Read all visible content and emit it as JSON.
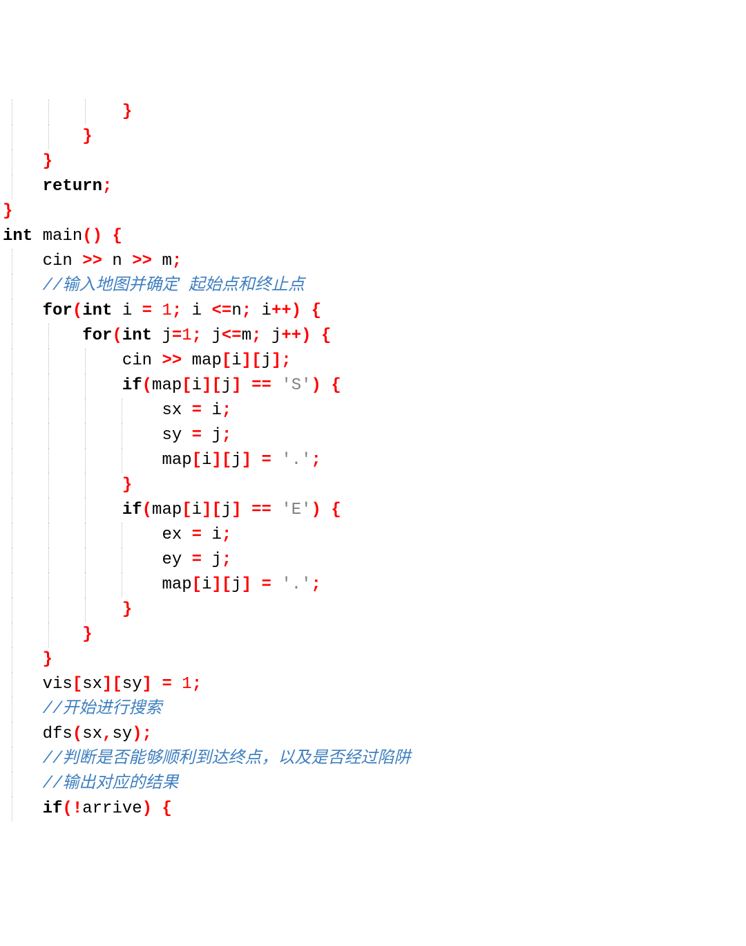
{
  "lines": [
    {
      "indent": "            ",
      "tokens": [
        {
          "t": "}",
          "c": "br"
        }
      ]
    },
    {
      "indent": "        ",
      "tokens": [
        {
          "t": "}",
          "c": "br"
        }
      ]
    },
    {
      "indent": "    ",
      "tokens": [
        {
          "t": "}",
          "c": "br"
        }
      ]
    },
    {
      "indent": "    ",
      "tokens": [
        {
          "t": "return",
          "c": "kw"
        },
        {
          "t": ";",
          "c": "op"
        }
      ]
    },
    {
      "indent": "",
      "tokens": [
        {
          "t": "}",
          "c": "br"
        }
      ]
    },
    {
      "indent": "",
      "tokens": [
        {
          "t": "int ",
          "c": "kw"
        },
        {
          "t": "main",
          "c": "id"
        },
        {
          "t": "()",
          "c": "br"
        },
        {
          "t": " ",
          "c": "id"
        },
        {
          "t": "{",
          "c": "br"
        }
      ]
    },
    {
      "indent": "    ",
      "tokens": [
        {
          "t": "cin ",
          "c": "id"
        },
        {
          "t": ">>",
          "c": "op"
        },
        {
          "t": " n ",
          "c": "id"
        },
        {
          "t": ">>",
          "c": "op"
        },
        {
          "t": " m",
          "c": "id"
        },
        {
          "t": ";",
          "c": "op"
        }
      ]
    },
    {
      "indent": "    ",
      "tokens": [
        {
          "t": "//输入地图并确定 起始点和终止点",
          "c": "cm"
        }
      ]
    },
    {
      "indent": "    ",
      "tokens": [
        {
          "t": "for",
          "c": "kw"
        },
        {
          "t": "(",
          "c": "br"
        },
        {
          "t": "int ",
          "c": "kw"
        },
        {
          "t": "i ",
          "c": "id"
        },
        {
          "t": "= ",
          "c": "op"
        },
        {
          "t": "1",
          "c": "num"
        },
        {
          "t": ";",
          "c": "op"
        },
        {
          "t": " i ",
          "c": "id"
        },
        {
          "t": "<=",
          "c": "op"
        },
        {
          "t": "n",
          "c": "id"
        },
        {
          "t": ";",
          "c": "op"
        },
        {
          "t": " i",
          "c": "id"
        },
        {
          "t": "++",
          "c": "op"
        },
        {
          "t": ")",
          "c": "br"
        },
        {
          "t": " ",
          "c": "id"
        },
        {
          "t": "{",
          "c": "br"
        }
      ]
    },
    {
      "indent": "        ",
      "tokens": [
        {
          "t": "for",
          "c": "kw"
        },
        {
          "t": "(",
          "c": "br"
        },
        {
          "t": "int ",
          "c": "kw"
        },
        {
          "t": "j",
          "c": "id"
        },
        {
          "t": "=",
          "c": "op"
        },
        {
          "t": "1",
          "c": "num"
        },
        {
          "t": ";",
          "c": "op"
        },
        {
          "t": " j",
          "c": "id"
        },
        {
          "t": "<=",
          "c": "op"
        },
        {
          "t": "m",
          "c": "id"
        },
        {
          "t": ";",
          "c": "op"
        },
        {
          "t": " j",
          "c": "id"
        },
        {
          "t": "++",
          "c": "op"
        },
        {
          "t": ")",
          "c": "br"
        },
        {
          "t": " ",
          "c": "id"
        },
        {
          "t": "{",
          "c": "br"
        }
      ]
    },
    {
      "indent": "            ",
      "tokens": [
        {
          "t": "cin ",
          "c": "id"
        },
        {
          "t": ">>",
          "c": "op"
        },
        {
          "t": " map",
          "c": "id"
        },
        {
          "t": "[",
          "c": "br"
        },
        {
          "t": "i",
          "c": "id"
        },
        {
          "t": "][",
          "c": "br"
        },
        {
          "t": "j",
          "c": "id"
        },
        {
          "t": "]",
          "c": "br"
        },
        {
          "t": ";",
          "c": "op"
        }
      ]
    },
    {
      "indent": "            ",
      "tokens": [
        {
          "t": "if",
          "c": "kw"
        },
        {
          "t": "(",
          "c": "br"
        },
        {
          "t": "map",
          "c": "id"
        },
        {
          "t": "[",
          "c": "br"
        },
        {
          "t": "i",
          "c": "id"
        },
        {
          "t": "][",
          "c": "br"
        },
        {
          "t": "j",
          "c": "id"
        },
        {
          "t": "]",
          "c": "br"
        },
        {
          "t": " ",
          "c": "id"
        },
        {
          "t": "==",
          "c": "op"
        },
        {
          "t": " ",
          "c": "id"
        },
        {
          "t": "'S'",
          "c": "str"
        },
        {
          "t": ")",
          "c": "br"
        },
        {
          "t": " ",
          "c": "id"
        },
        {
          "t": "{",
          "c": "br"
        }
      ]
    },
    {
      "indent": "                ",
      "tokens": [
        {
          "t": "sx ",
          "c": "id"
        },
        {
          "t": "=",
          "c": "op"
        },
        {
          "t": " i",
          "c": "id"
        },
        {
          "t": ";",
          "c": "op"
        }
      ]
    },
    {
      "indent": "                ",
      "tokens": [
        {
          "t": "sy ",
          "c": "id"
        },
        {
          "t": "=",
          "c": "op"
        },
        {
          "t": " j",
          "c": "id"
        },
        {
          "t": ";",
          "c": "op"
        }
      ]
    },
    {
      "indent": "                ",
      "tokens": [
        {
          "t": "map",
          "c": "id"
        },
        {
          "t": "[",
          "c": "br"
        },
        {
          "t": "i",
          "c": "id"
        },
        {
          "t": "][",
          "c": "br"
        },
        {
          "t": "j",
          "c": "id"
        },
        {
          "t": "]",
          "c": "br"
        },
        {
          "t": " ",
          "c": "id"
        },
        {
          "t": "=",
          "c": "op"
        },
        {
          "t": " ",
          "c": "id"
        },
        {
          "t": "'.'",
          "c": "str"
        },
        {
          "t": ";",
          "c": "op"
        }
      ]
    },
    {
      "indent": "            ",
      "tokens": [
        {
          "t": "}",
          "c": "br"
        }
      ]
    },
    {
      "indent": "            ",
      "tokens": [
        {
          "t": "if",
          "c": "kw"
        },
        {
          "t": "(",
          "c": "br"
        },
        {
          "t": "map",
          "c": "id"
        },
        {
          "t": "[",
          "c": "br"
        },
        {
          "t": "i",
          "c": "id"
        },
        {
          "t": "][",
          "c": "br"
        },
        {
          "t": "j",
          "c": "id"
        },
        {
          "t": "]",
          "c": "br"
        },
        {
          "t": " ",
          "c": "id"
        },
        {
          "t": "==",
          "c": "op"
        },
        {
          "t": " ",
          "c": "id"
        },
        {
          "t": "'E'",
          "c": "str"
        },
        {
          "t": ")",
          "c": "br"
        },
        {
          "t": " ",
          "c": "id"
        },
        {
          "t": "{",
          "c": "br"
        }
      ]
    },
    {
      "indent": "                ",
      "tokens": [
        {
          "t": "ex ",
          "c": "id"
        },
        {
          "t": "=",
          "c": "op"
        },
        {
          "t": " i",
          "c": "id"
        },
        {
          "t": ";",
          "c": "op"
        }
      ]
    },
    {
      "indent": "                ",
      "tokens": [
        {
          "t": "ey ",
          "c": "id"
        },
        {
          "t": "=",
          "c": "op"
        },
        {
          "t": " j",
          "c": "id"
        },
        {
          "t": ";",
          "c": "op"
        }
      ]
    },
    {
      "indent": "                ",
      "tokens": [
        {
          "t": "map",
          "c": "id"
        },
        {
          "t": "[",
          "c": "br"
        },
        {
          "t": "i",
          "c": "id"
        },
        {
          "t": "][",
          "c": "br"
        },
        {
          "t": "j",
          "c": "id"
        },
        {
          "t": "]",
          "c": "br"
        },
        {
          "t": " ",
          "c": "id"
        },
        {
          "t": "=",
          "c": "op"
        },
        {
          "t": " ",
          "c": "id"
        },
        {
          "t": "'.'",
          "c": "str"
        },
        {
          "t": ";",
          "c": "op"
        }
      ]
    },
    {
      "indent": "            ",
      "tokens": [
        {
          "t": "}",
          "c": "br"
        }
      ]
    },
    {
      "indent": "        ",
      "tokens": [
        {
          "t": "}",
          "c": "br"
        }
      ]
    },
    {
      "indent": "    ",
      "tokens": [
        {
          "t": "}",
          "c": "br"
        }
      ]
    },
    {
      "indent": "    ",
      "tokens": [
        {
          "t": "vis",
          "c": "id"
        },
        {
          "t": "[",
          "c": "br"
        },
        {
          "t": "sx",
          "c": "id"
        },
        {
          "t": "][",
          "c": "br"
        },
        {
          "t": "sy",
          "c": "id"
        },
        {
          "t": "]",
          "c": "br"
        },
        {
          "t": " ",
          "c": "id"
        },
        {
          "t": "=",
          "c": "op"
        },
        {
          "t": " ",
          "c": "id"
        },
        {
          "t": "1",
          "c": "num"
        },
        {
          "t": ";",
          "c": "op"
        }
      ]
    },
    {
      "indent": "    ",
      "tokens": [
        {
          "t": "//开始进行搜索",
          "c": "cm"
        }
      ]
    },
    {
      "indent": "    ",
      "tokens": [
        {
          "t": "dfs",
          "c": "id"
        },
        {
          "t": "(",
          "c": "br"
        },
        {
          "t": "sx",
          "c": "id"
        },
        {
          "t": ",",
          "c": "op"
        },
        {
          "t": "sy",
          "c": "id"
        },
        {
          "t": ")",
          "c": "br"
        },
        {
          "t": ";",
          "c": "op"
        }
      ]
    },
    {
      "indent": "    ",
      "tokens": [
        {
          "t": "//判断是否能够顺利到达终点，以及是否经过陷阱",
          "c": "cm"
        }
      ]
    },
    {
      "indent": "    ",
      "tokens": [
        {
          "t": "//输出对应的结果",
          "c": "cm"
        }
      ]
    },
    {
      "indent": "    ",
      "tokens": [
        {
          "t": "if",
          "c": "kw"
        },
        {
          "t": "(!",
          "c": "br"
        },
        {
          "t": "arrive",
          "c": "id"
        },
        {
          "t": ")",
          "c": "br"
        },
        {
          "t": " ",
          "c": "id"
        },
        {
          "t": "{",
          "c": "br"
        }
      ]
    }
  ]
}
